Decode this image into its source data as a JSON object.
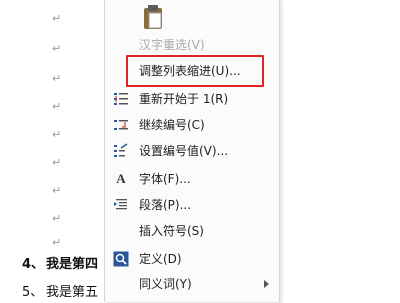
{
  "document": {
    "paragraph_mark": "↵",
    "lines": [
      {
        "number": "4、",
        "text": "我是第四"
      },
      {
        "number": "5、",
        "text": "我是第五"
      }
    ]
  },
  "context_menu": {
    "items": [
      {
        "label": "汉字重选(V)",
        "icon": "none",
        "disabled": true
      },
      {
        "label": "调整列表缩进(U)...",
        "icon": "none",
        "highlighted": true
      },
      {
        "label": "重新开始于 1(R)",
        "icon": "restart-numbering-icon"
      },
      {
        "label": "继续编号(C)",
        "icon": "continue-numbering-icon"
      },
      {
        "label": "设置编号值(V)...",
        "icon": "set-numbering-value-icon"
      },
      {
        "label": "字体(F)...",
        "icon": "font-icon"
      },
      {
        "label": "段落(P)...",
        "icon": "paragraph-icon"
      },
      {
        "label": "插入符号(S)",
        "icon": "none"
      },
      {
        "label": "定义(D)",
        "icon": "define-icon"
      },
      {
        "label": "同义词(Y)",
        "icon": "none",
        "submenu": true
      }
    ],
    "highlight_color": "#e02424"
  }
}
